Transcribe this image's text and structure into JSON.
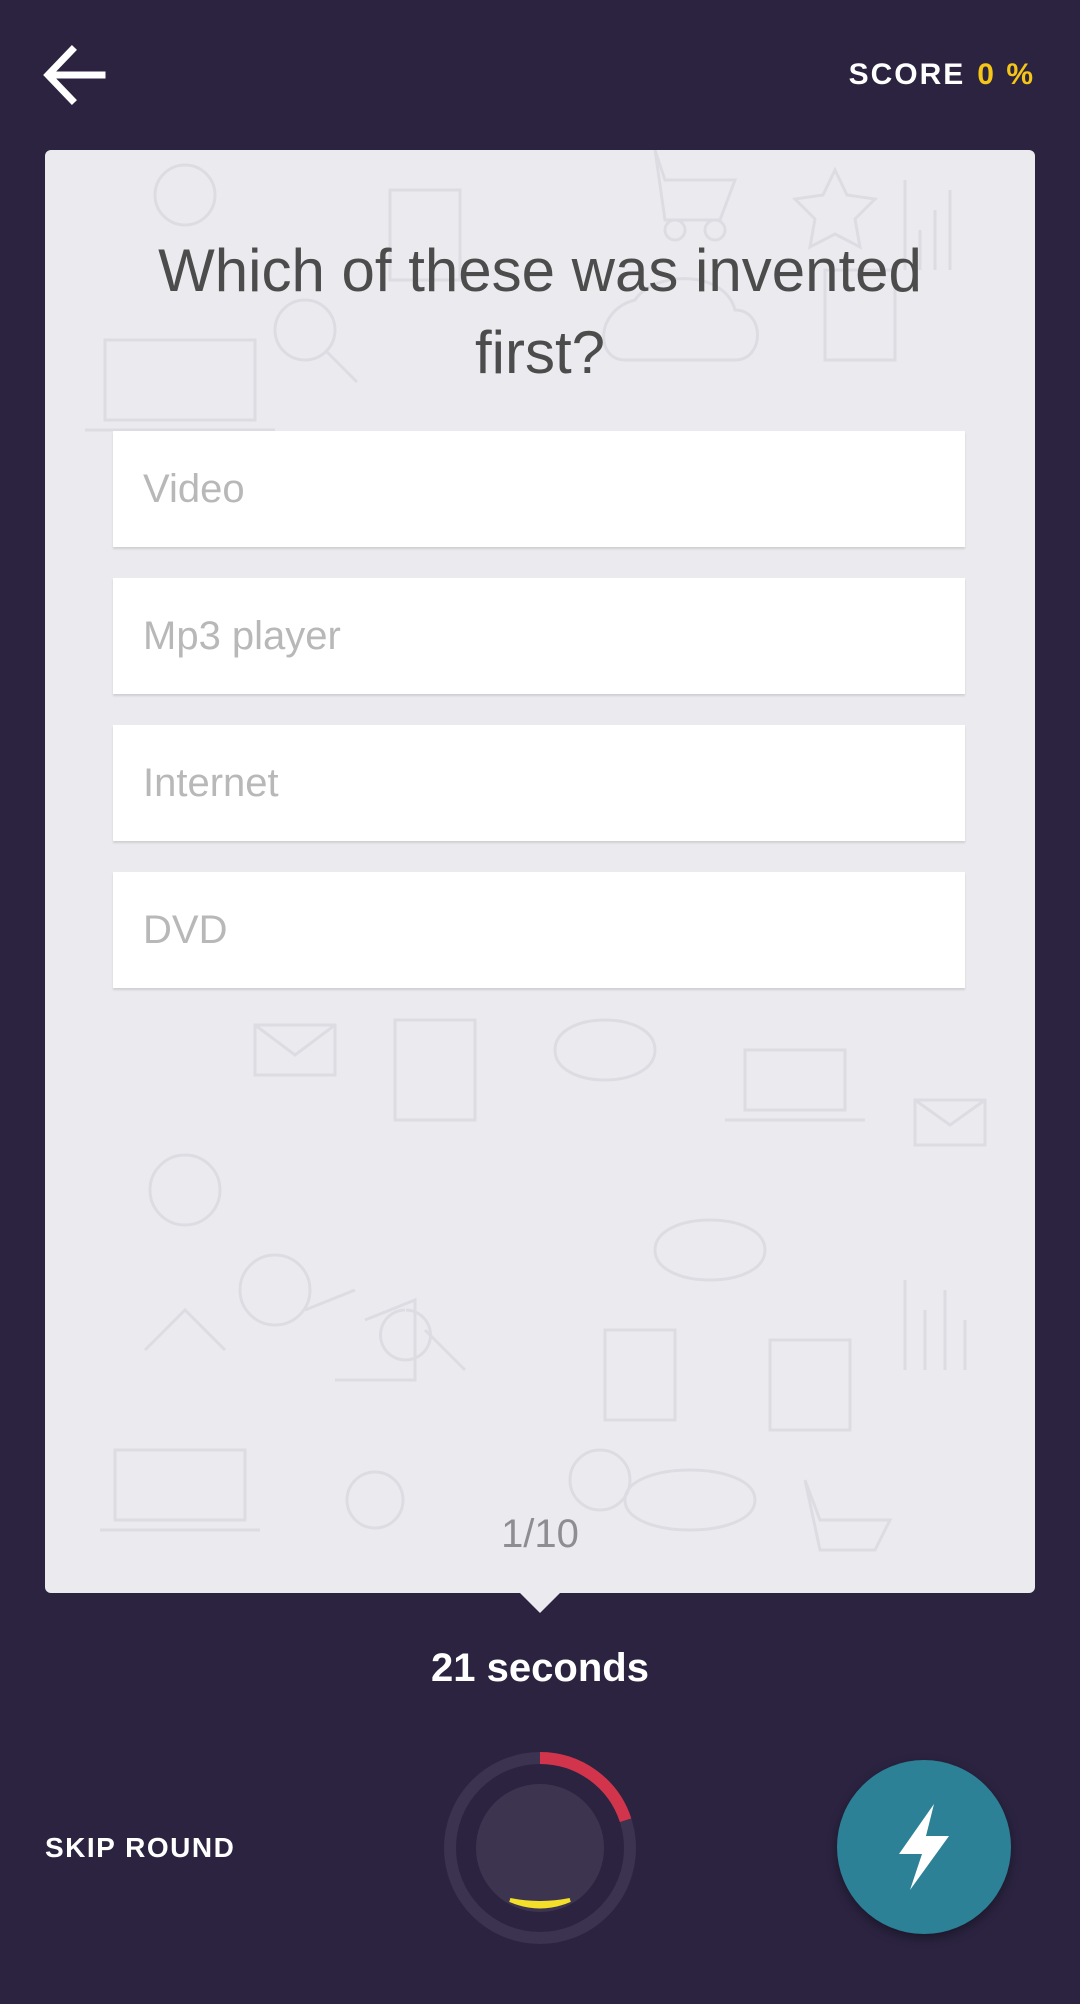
{
  "header": {
    "score_label": "SCORE",
    "score_value": "0 %"
  },
  "question": {
    "text": "Which of these was invented first?"
  },
  "options": [
    {
      "label": "Video"
    },
    {
      "label": "Mp3 player"
    },
    {
      "label": "Internet"
    },
    {
      "label": "DVD"
    }
  ],
  "progress": {
    "text": "1/10"
  },
  "timer": {
    "text": "21 seconds",
    "fraction_elapsed": 0.2
  },
  "footer": {
    "skip_label": "SKIP ROUND"
  },
  "colors": {
    "background": "#2b2340",
    "accent_score": "#f5c518",
    "timer_ring": "#d2354b",
    "boost_button": "#2c8197"
  },
  "icons": {
    "back": "arrow-left-icon",
    "boost": "lightning-bolt-icon"
  }
}
